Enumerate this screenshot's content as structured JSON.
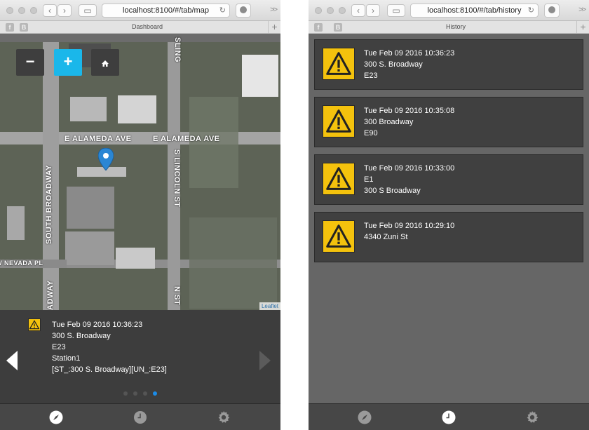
{
  "left": {
    "browser": {
      "address": "localhost:8100/#/tab/map",
      "tab_title": "Dashboard",
      "fav1": "f",
      "fav2": "B",
      "more": ">>",
      "new_tab": "+"
    },
    "map": {
      "zoom_out": "−",
      "zoom_in": "+",
      "home_icon": "home-icon",
      "streets": {
        "alameda_1": "E ALAMEDA AVE",
        "alameda_2": "E ALAMEDA AVE",
        "south_broadway": "SOUTH BROADWAY",
        "lincoln": "S LINCOLN ST",
        "nevada": "W NEVADA PL",
        "sling": "SLING",
        "adway": "ADWAY",
        "nst": "N ST"
      },
      "attribution": "Leaflet"
    },
    "detail": {
      "lines": [
        "Tue Feb 09 2016 10:36:23",
        "300 S. Broadway",
        "E23",
        "Station1",
        "[ST_:300 S. Broadway][UN_:E23]"
      ],
      "active_page": 4,
      "page_count": 4
    },
    "nav": {
      "active": "dashboard"
    }
  },
  "right": {
    "browser": {
      "address": "localhost:8100/#/tab/history",
      "tab_title": "History",
      "fav1": "f",
      "fav2": "B",
      "more": ">>",
      "new_tab": "+"
    },
    "history": [
      {
        "lines": [
          "Tue Feb 09 2016 10:36:23",
          "300 S. Broadway",
          "E23"
        ]
      },
      {
        "lines": [
          "Tue Feb 09 2016 10:35:08",
          "300 Broadway",
          "E90"
        ]
      },
      {
        "lines": [
          "Tue Feb 09 2016 10:33:00",
          "E1",
          "300 S Broadway"
        ]
      },
      {
        "lines": [
          "Tue Feb 09 2016 10:29:10",
          "4340 Zuni St"
        ]
      }
    ],
    "nav": {
      "active": "history"
    }
  },
  "colors": {
    "accent": "#1ab7ea",
    "warning": "#f4c20d",
    "dot_active": "#1b8ce8"
  }
}
